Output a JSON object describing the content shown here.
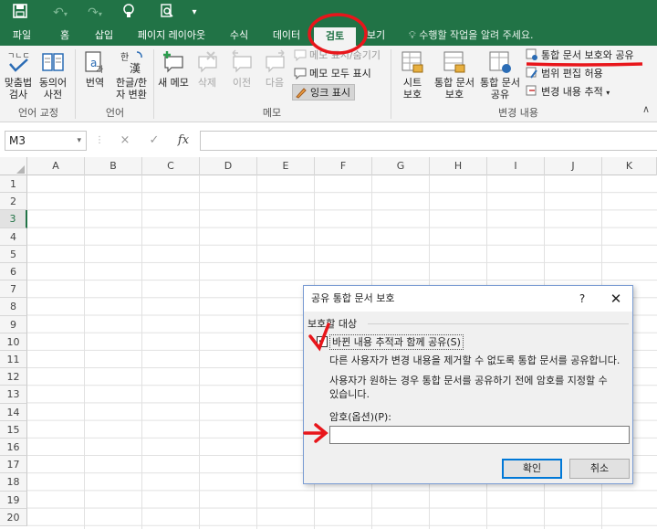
{
  "ribbon_tabs": [
    "파일",
    "홈",
    "삽입",
    "페이지 레이아웃",
    "수식",
    "데이터",
    "검토",
    "보기"
  ],
  "tell_me": "수행할 작업을 알려 주세요.",
  "ribbon": {
    "spell_check": "맞춤법\n검사",
    "thesaurus": "동의어\n사전",
    "translate": "번역",
    "han_hanja": "한글/한\n자 변환",
    "new_comment": "새 메모",
    "delete": "삭제",
    "previous": "이전",
    "next": "다음",
    "show_hide_comment": "메모 표시/숨기기",
    "show_all_comments": "메모 모두 표시",
    "show_ink": "잉크 표시",
    "protect_sheet": "시트\n보호",
    "protect_workbook": "통합 문서\n보호",
    "share_workbook": "통합 문서\n공유",
    "protect_and_share": "통합 문서 보호와 공유",
    "allow_edit_ranges": "범위 편집 허용",
    "track_changes": "변경 내용 추적",
    "groups": {
      "proofing": "언어 교정",
      "language": "언어",
      "comments": "메모",
      "changes": "변경 내용"
    }
  },
  "formula_bar": {
    "name_box": "M3",
    "cancel_icon": "×",
    "enter_icon": "✓",
    "fx": "fx"
  },
  "columns": [
    "A",
    "B",
    "C",
    "D",
    "E",
    "F",
    "G",
    "H",
    "I",
    "J",
    "K"
  ],
  "rows": [
    "1",
    "2",
    "3",
    "4",
    "5",
    "6",
    "7",
    "8",
    "9",
    "10",
    "11",
    "12",
    "13",
    "14",
    "15",
    "16",
    "17",
    "18",
    "19",
    "20"
  ],
  "dialog": {
    "title": "공유 통합 문서 보호",
    "help": "?",
    "close": "✕",
    "section": "보호할 대상",
    "checkbox_label": "바뀐 내용 추적과 함께 공유(S)",
    "checked": true,
    "desc1": "다른 사용자가 변경 내용을 제거할 수 없도록 통합 문서를 공유합니다.",
    "desc2": "사용자가 원하는 경우 통합 문서를 공유하기 전에 암호를 지정할 수\n있습니다.",
    "password_label": "암호(옵션)(P):",
    "password_value": "",
    "ok": "확인",
    "cancel": "취소"
  },
  "colors": {
    "excel_green": "#217346",
    "annotation_red": "#e8161b"
  }
}
